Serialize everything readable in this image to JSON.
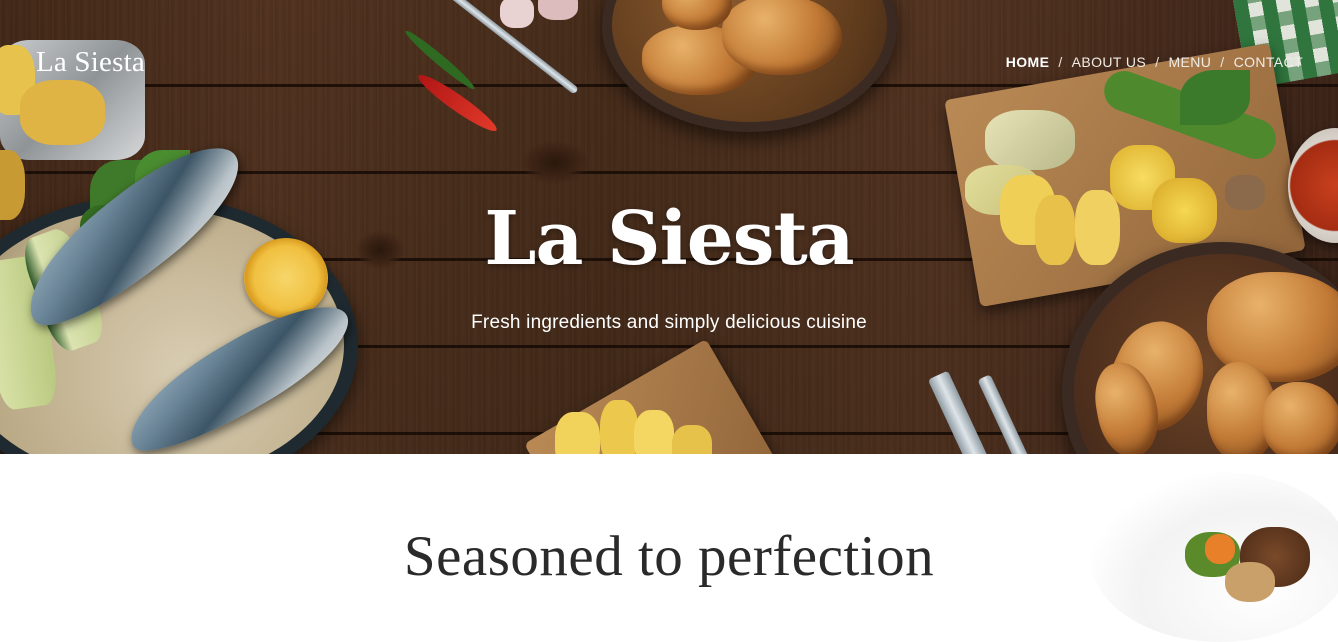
{
  "brand": {
    "logo_text": "La Siesta"
  },
  "nav": {
    "items": [
      {
        "label": "HOME",
        "active": true
      },
      {
        "label": "ABOUT US",
        "active": false
      },
      {
        "label": "MENU",
        "active": false
      },
      {
        "label": "CONTACT",
        "active": false
      }
    ],
    "separator": "/"
  },
  "hero": {
    "title": "La Siesta",
    "subtitle": "Fresh ingredients and simply delicious cuisine"
  },
  "section": {
    "title": "Seasoned to perfection"
  },
  "colors": {
    "nav_text": "#ffffff",
    "section_title": "#2a2a2a",
    "hero_wood": "#4e301c"
  }
}
